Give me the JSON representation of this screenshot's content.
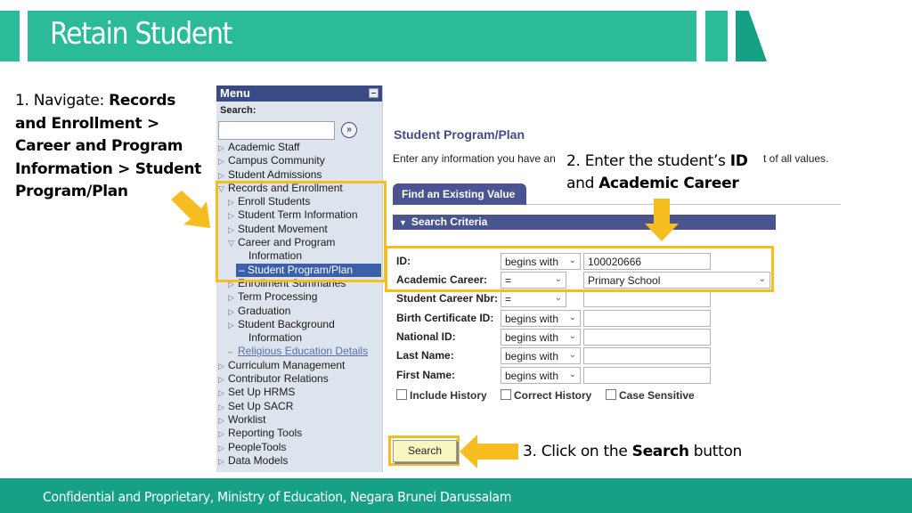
{
  "header": {
    "title": "Retain Student"
  },
  "instructions": {
    "step1": {
      "prefix": "1. Navigate: ",
      "path": "Records and Enrollment > Career and Program Information > Student Program/Plan"
    },
    "step2": {
      "prefix": "2. Enter the student’s ",
      "bold1": "ID",
      "mid": " and ",
      "bold2": "Academic Career"
    },
    "step3": {
      "prefix": "3. Click on the ",
      "bold": "Search",
      "suffix": " button"
    }
  },
  "menu": {
    "title": "Menu",
    "search_label": "Search:",
    "search_value": "",
    "go_icon": "»",
    "items": [
      {
        "label": "Academic Staff",
        "level": 0,
        "icon": "triangle-right"
      },
      {
        "label": "Campus Community",
        "level": 0,
        "icon": "triangle-right"
      },
      {
        "label": "Student Admissions",
        "level": 0,
        "icon": "triangle-right"
      },
      {
        "label": "Records and Enrollment",
        "level": 0,
        "icon": "triangle-down"
      },
      {
        "label": "Enroll Students",
        "level": 1,
        "icon": "triangle-right"
      },
      {
        "label": "Student Term Information",
        "level": 1,
        "icon": "triangle-right"
      },
      {
        "label": "Student Movement",
        "level": 1,
        "icon": "triangle-right"
      },
      {
        "label": "Career and Program",
        "level": 1,
        "icon": "triangle-down"
      },
      {
        "label": "Information",
        "level": 2,
        "icon": ""
      },
      {
        "label": "– Student Program/Plan",
        "level": 2,
        "icon": "",
        "selected": true
      },
      {
        "label": "Enrollment Summaries",
        "level": 1,
        "icon": "triangle-right"
      },
      {
        "label": "Term Processing",
        "level": 1,
        "icon": "triangle-right"
      },
      {
        "label": "Graduation",
        "level": 1,
        "icon": "triangle-right"
      },
      {
        "label": "Student Background",
        "level": 1,
        "icon": "triangle-right"
      },
      {
        "label": "Information",
        "level": 2,
        "icon": ""
      },
      {
        "label": "Religious Education Details",
        "level": 1,
        "icon": "dash",
        "link": true
      },
      {
        "label": "Curriculum Management",
        "level": 0,
        "icon": "triangle-right"
      },
      {
        "label": "Contributor Relations",
        "level": 0,
        "icon": "triangle-right"
      },
      {
        "label": "Set Up HRMS",
        "level": 0,
        "icon": "triangle-right"
      },
      {
        "label": "Set Up SACR",
        "level": 0,
        "icon": "triangle-right"
      },
      {
        "label": "Worklist",
        "level": 0,
        "icon": "triangle-right"
      },
      {
        "label": "Reporting Tools",
        "level": 0,
        "icon": "triangle-right"
      },
      {
        "label": "PeopleTools",
        "level": 0,
        "icon": "triangle-right"
      },
      {
        "label": "Data Models",
        "level": 0,
        "icon": "triangle-right"
      }
    ]
  },
  "page": {
    "title": "Student Program/Plan",
    "description_start": "Enter any information you have an",
    "description_end": "t of all values.",
    "tab_label": "Find an Existing Value",
    "section_label": "Search Criteria",
    "fields": [
      {
        "label": "ID:",
        "operator": "begins with",
        "value": "100020666"
      },
      {
        "label": "Academic Career:",
        "operator": "=",
        "value": "Primary School"
      },
      {
        "label": "Student Career Nbr:",
        "operator": "=",
        "value": ""
      },
      {
        "label": "Birth Certificate ID:",
        "operator": "begins with",
        "value": ""
      },
      {
        "label": "National ID:",
        "operator": "begins with",
        "value": ""
      },
      {
        "label": "Last Name:",
        "operator": "begins with",
        "value": ""
      },
      {
        "label": "First Name:",
        "operator": "begins with",
        "value": ""
      }
    ],
    "checkboxes": [
      {
        "label": "Include History",
        "checked": false
      },
      {
        "label": "Correct History",
        "checked": false
      },
      {
        "label": "Case Sensitive",
        "checked": false
      }
    ],
    "search_button": "Search"
  },
  "footer": {
    "text": "Confidential and Proprietary, Ministry of Education, Negara Brunei Darussalam"
  },
  "colors": {
    "banner": "#2bbb98",
    "footer": "#16a085",
    "highlight": "#f5bd1f",
    "menu_header": "#3a4a85"
  }
}
